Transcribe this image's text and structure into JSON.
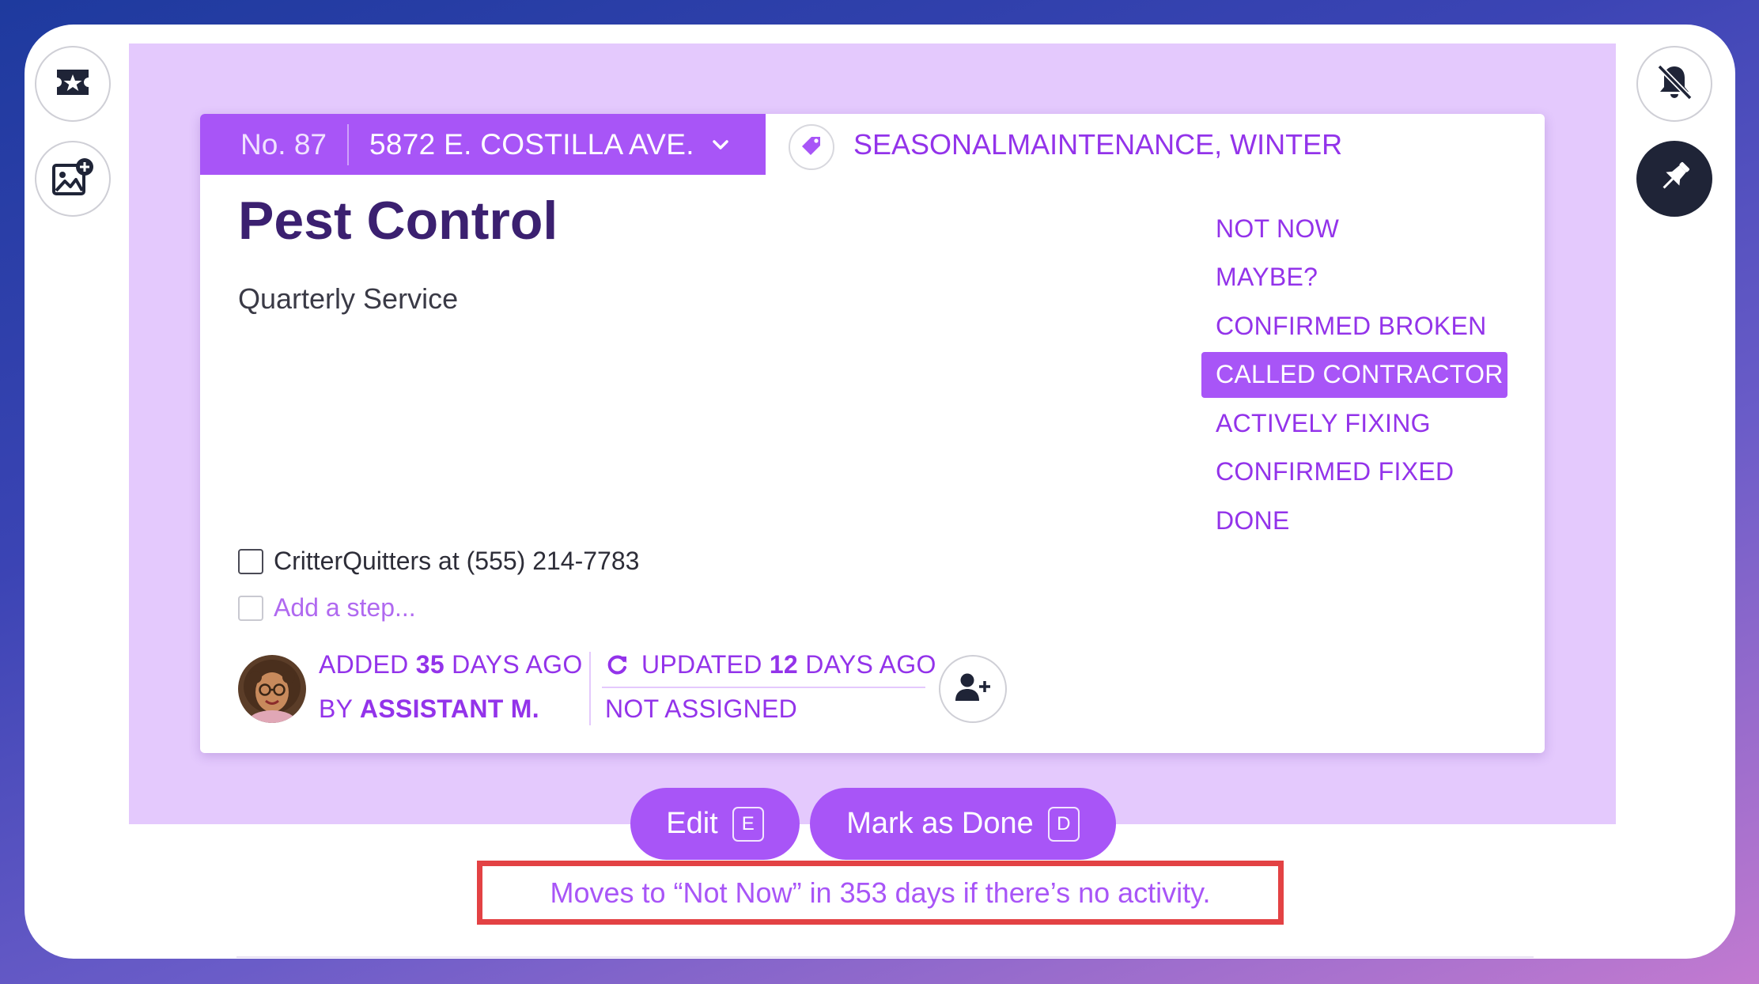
{
  "card": {
    "number": "No. 87",
    "address": "5872 E. COSTILLA AVE.",
    "tags": "SEASONALMAINTENANCE, WINTER",
    "title": "Pest Control",
    "subtitle": "Quarterly Service",
    "statuses": [
      {
        "label": "NOT NOW",
        "active": false
      },
      {
        "label": "MAYBE?",
        "active": false
      },
      {
        "label": "CONFIRMED BROKEN",
        "active": false
      },
      {
        "label": "CALLED CONTRACTOR",
        "active": true
      },
      {
        "label": "ACTIVELY FIXING",
        "active": false
      },
      {
        "label": "CONFIRMED FIXED",
        "active": false
      },
      {
        "label": "DONE",
        "active": false
      }
    ],
    "steps": [
      {
        "label": "CritterQuitters at (555) 214-7783",
        "checked": false
      }
    ],
    "add_step_placeholder": "Add a step...",
    "meta": {
      "added_prefix": "ADDED ",
      "added_days": "35",
      "added_suffix": " DAYS AGO",
      "by_prefix": "BY ",
      "by_name": "ASSISTANT M.",
      "updated_prefix": "UPDATED ",
      "updated_days": "12",
      "updated_suffix": " DAYS AGO",
      "assigned": "NOT ASSIGNED"
    }
  },
  "actions": {
    "edit_label": "Edit",
    "edit_key": "E",
    "done_label": "Mark as Done",
    "done_key": "D"
  },
  "notice": "Moves to “Not Now” in 353 days if there’s no activity.",
  "icons": {
    "left": [
      "ticket-star-icon",
      "add-image-icon"
    ],
    "right": [
      "bell-off-icon",
      "pin-icon"
    ]
  },
  "colors": {
    "accent": "#a855f7",
    "panel": "#e4c9fd",
    "title": "#3b2070",
    "highlight_border": "#e34244"
  }
}
